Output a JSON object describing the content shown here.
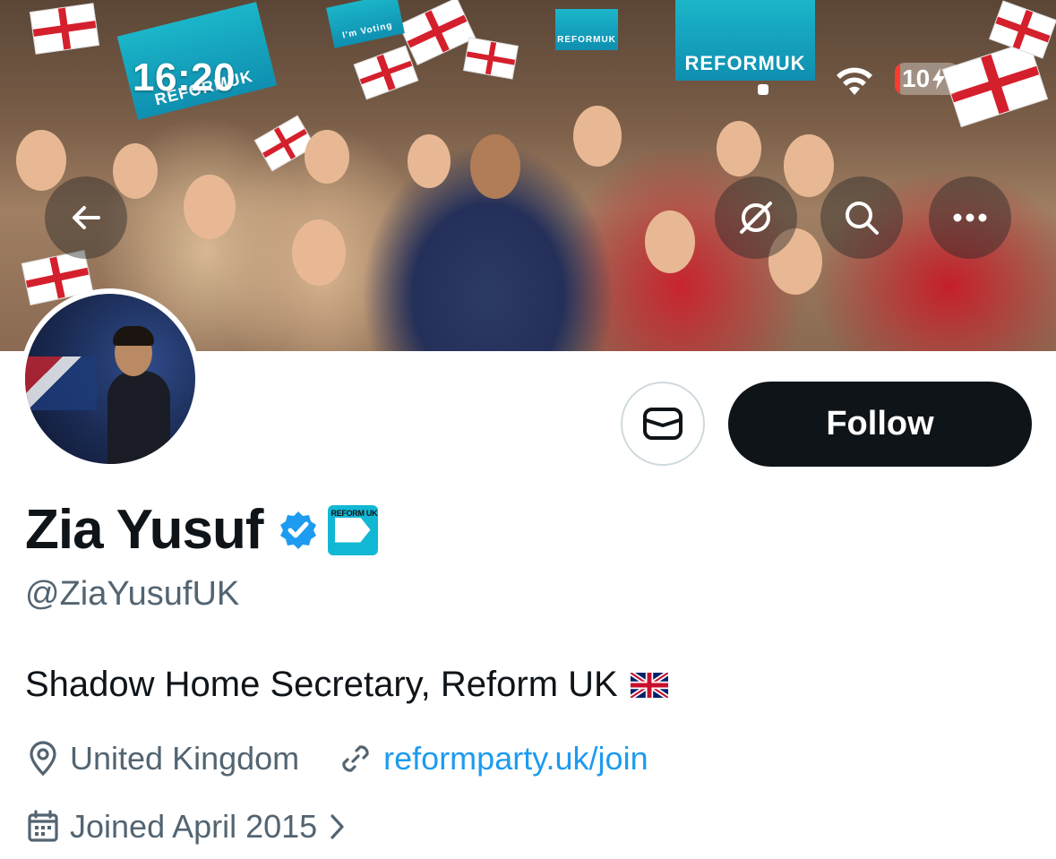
{
  "status_bar": {
    "time": "16:20",
    "battery": "10"
  },
  "banner": {
    "signs": [
      "I'm Voting",
      "REFORMUK",
      "REFORMUK",
      "REFORMUK"
    ]
  },
  "header_actions": [
    "back-arrow-icon",
    "translate-icon",
    "search-icon",
    "more-icon"
  ],
  "profile": {
    "name": "Zia Yusuf",
    "verified": true,
    "affiliation_label": "REFORM UK",
    "handle": "@ZiaYusufUK",
    "bio": "Shadow Home Secretary, Reform UK",
    "bio_emoji": "uk-flag",
    "location": "United Kingdom",
    "website": "reformparty.uk/join",
    "joined": "Joined April 2015"
  },
  "buttons": {
    "follow": "Follow"
  },
  "colors": {
    "follow_bg": "#0f1419",
    "link": "#1d9bf0",
    "verified": "#1d9bf0",
    "muted": "#536471",
    "affiliation": "#12b7d4"
  }
}
